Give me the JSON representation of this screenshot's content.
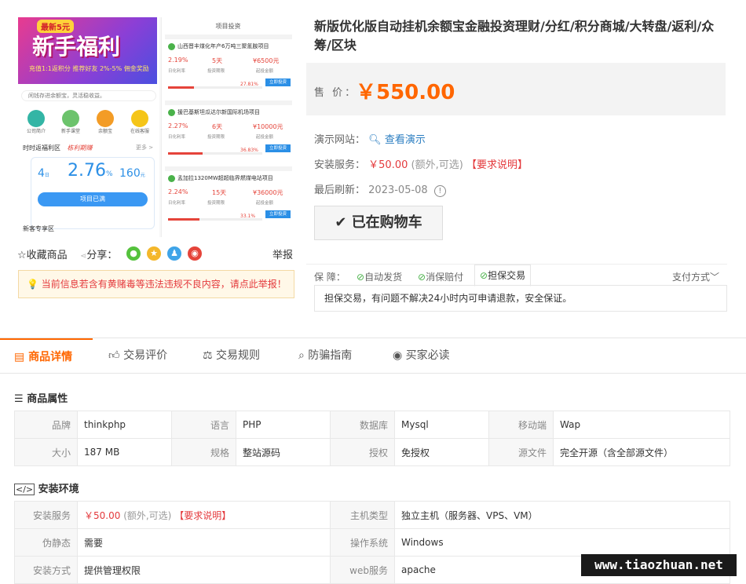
{
  "preview": {
    "banner_tag": "最新5元",
    "banner_title": "新手福利",
    "banner_sub": "充值1:1返积分 推荐好友 2%-5% 佣金奖励",
    "notice": "闲钱存进余额宝，灵活稳收益。",
    "quick_icons": [
      "公司简介",
      "新手课堂",
      "余额宝",
      "在线客服"
    ],
    "checkin_label": "时时返福利区",
    "checkin_brand": "栋利期赚",
    "more": "更多 >",
    "stat1": "4",
    "stat1_unit": "日",
    "stat2": "2.76",
    "stat2_unit": "%",
    "stat3": "160",
    "stat3_unit": "元",
    "stat_btn": "项目已满",
    "newbie": "新客专享区",
    "right_title": "项目投资",
    "projects": [
      {
        "name": "山西晋丰煤化年产6万吨三聚氰胺项目",
        "rate": "2.19%",
        "days": "5天",
        "amount": "¥6500元",
        "pct": "27.81%",
        "fill": 0.2781
      },
      {
        "name": "援巴基斯坦瓜达尔新国际机场项目",
        "rate": "2.27%",
        "days": "6天",
        "amount": "¥10000元",
        "pct": "36.83%",
        "fill": 0.3683
      },
      {
        "name": "孟加拉1320MW超超临界燃煤电站项目",
        "rate": "2.24%",
        "days": "15天",
        "amount": "¥36000元",
        "pct": "33.1%",
        "fill": 0.331
      }
    ],
    "proj_labels": [
      "日化利率",
      "投资期限",
      "起投金额"
    ],
    "proj_btn": "立即投资"
  },
  "share": {
    "favorite": "☆收藏商品",
    "share_label": "分享：",
    "report": "举报"
  },
  "warning": "当前信息若含有黄赌毒等违法违规不良内容，请点此举报！",
  "product": {
    "title": "新版优化版自动挂机余额宝金融投资理财/分红/积分商城/大转盘/返利/众筹/区块",
    "price_label": "售 价：",
    "price": "￥550.00",
    "demo_label": "演示网站：",
    "demo_link": "查看演示",
    "install_label": "安装服务：",
    "install_price": "￥50.00",
    "install_note": "(额外,可选)",
    "install_req": "【要求说明】",
    "refresh_label": "最后刷新：",
    "refresh_date": "2023-05-08",
    "cart_btn": "已在购物车",
    "guarantee_label": "保  障：",
    "guarantees": [
      "自动发货",
      "消保赔付",
      "担保交易"
    ],
    "pay_method": "支付方式",
    "guarantee_text": "担保交易，有问题不解决24小时内可申请退款，安全保证。"
  },
  "tabs": [
    "商品详情",
    "交易评价",
    "交易规则",
    "防骗指南",
    "买家必读"
  ],
  "attrs": {
    "title": "商品属性",
    "rows": [
      [
        [
          "品牌",
          "thinkphp"
        ],
        [
          "语言",
          "PHP"
        ],
        [
          "数据库",
          "Mysql"
        ],
        [
          "移动端",
          "Wap"
        ]
      ],
      [
        [
          "大小",
          "187 MB"
        ],
        [
          "规格",
          "整站源码"
        ],
        [
          "授权",
          "免授权"
        ],
        [
          "源文件",
          "完全开源（含全部源文件）"
        ]
      ]
    ]
  },
  "env": {
    "title": "安装环境",
    "install_label": "安装服务",
    "install_price": "￥50.00",
    "install_note": "(额外,可选)",
    "install_req": "【要求说明】",
    "host_label": "主机类型",
    "host_value": "独立主机（服务器、VPS、VM）",
    "pseudo_label": "伪静态",
    "pseudo_value": "需要",
    "os_label": "操作系统",
    "os_value": "Windows",
    "method_label": "安装方式",
    "method_value": "提供管理权限",
    "web_label": "web服务",
    "web_value": "apache"
  },
  "watermark": "www.tiaozhuan.net",
  "colors": {
    "accent": "#ff6600",
    "red": "#e4393c",
    "link": "#2b7ec1"
  }
}
